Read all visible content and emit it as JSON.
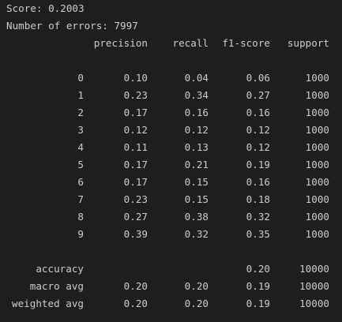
{
  "score_line": "Score: 0.2003",
  "errors_line": "Number of errors: 7997",
  "header": {
    "precision": "precision",
    "recall": "recall",
    "f1": "f1-score",
    "support": "support"
  },
  "class_rows": [
    {
      "label": "0",
      "precision": "0.10",
      "recall": "0.04",
      "f1": "0.06",
      "support": "1000"
    },
    {
      "label": "1",
      "precision": "0.23",
      "recall": "0.34",
      "f1": "0.27",
      "support": "1000"
    },
    {
      "label": "2",
      "precision": "0.17",
      "recall": "0.16",
      "f1": "0.16",
      "support": "1000"
    },
    {
      "label": "3",
      "precision": "0.12",
      "recall": "0.12",
      "f1": "0.12",
      "support": "1000"
    },
    {
      "label": "4",
      "precision": "0.11",
      "recall": "0.13",
      "f1": "0.12",
      "support": "1000"
    },
    {
      "label": "5",
      "precision": "0.17",
      "recall": "0.21",
      "f1": "0.19",
      "support": "1000"
    },
    {
      "label": "6",
      "precision": "0.17",
      "recall": "0.15",
      "f1": "0.16",
      "support": "1000"
    },
    {
      "label": "7",
      "precision": "0.23",
      "recall": "0.15",
      "f1": "0.18",
      "support": "1000"
    },
    {
      "label": "8",
      "precision": "0.27",
      "recall": "0.38",
      "f1": "0.32",
      "support": "1000"
    },
    {
      "label": "9",
      "precision": "0.39",
      "recall": "0.32",
      "f1": "0.35",
      "support": "1000"
    }
  ],
  "summary_rows": [
    {
      "label": "accuracy",
      "precision": "",
      "recall": "",
      "f1": "0.20",
      "support": "10000"
    },
    {
      "label": "macro avg",
      "precision": "0.20",
      "recall": "0.20",
      "f1": "0.19",
      "support": "10000"
    },
    {
      "label": "weighted avg",
      "precision": "0.20",
      "recall": "0.20",
      "f1": "0.19",
      "support": "10000"
    }
  ],
  "colors": {
    "background": "#1e1e1e",
    "text": "#cccccc"
  }
}
